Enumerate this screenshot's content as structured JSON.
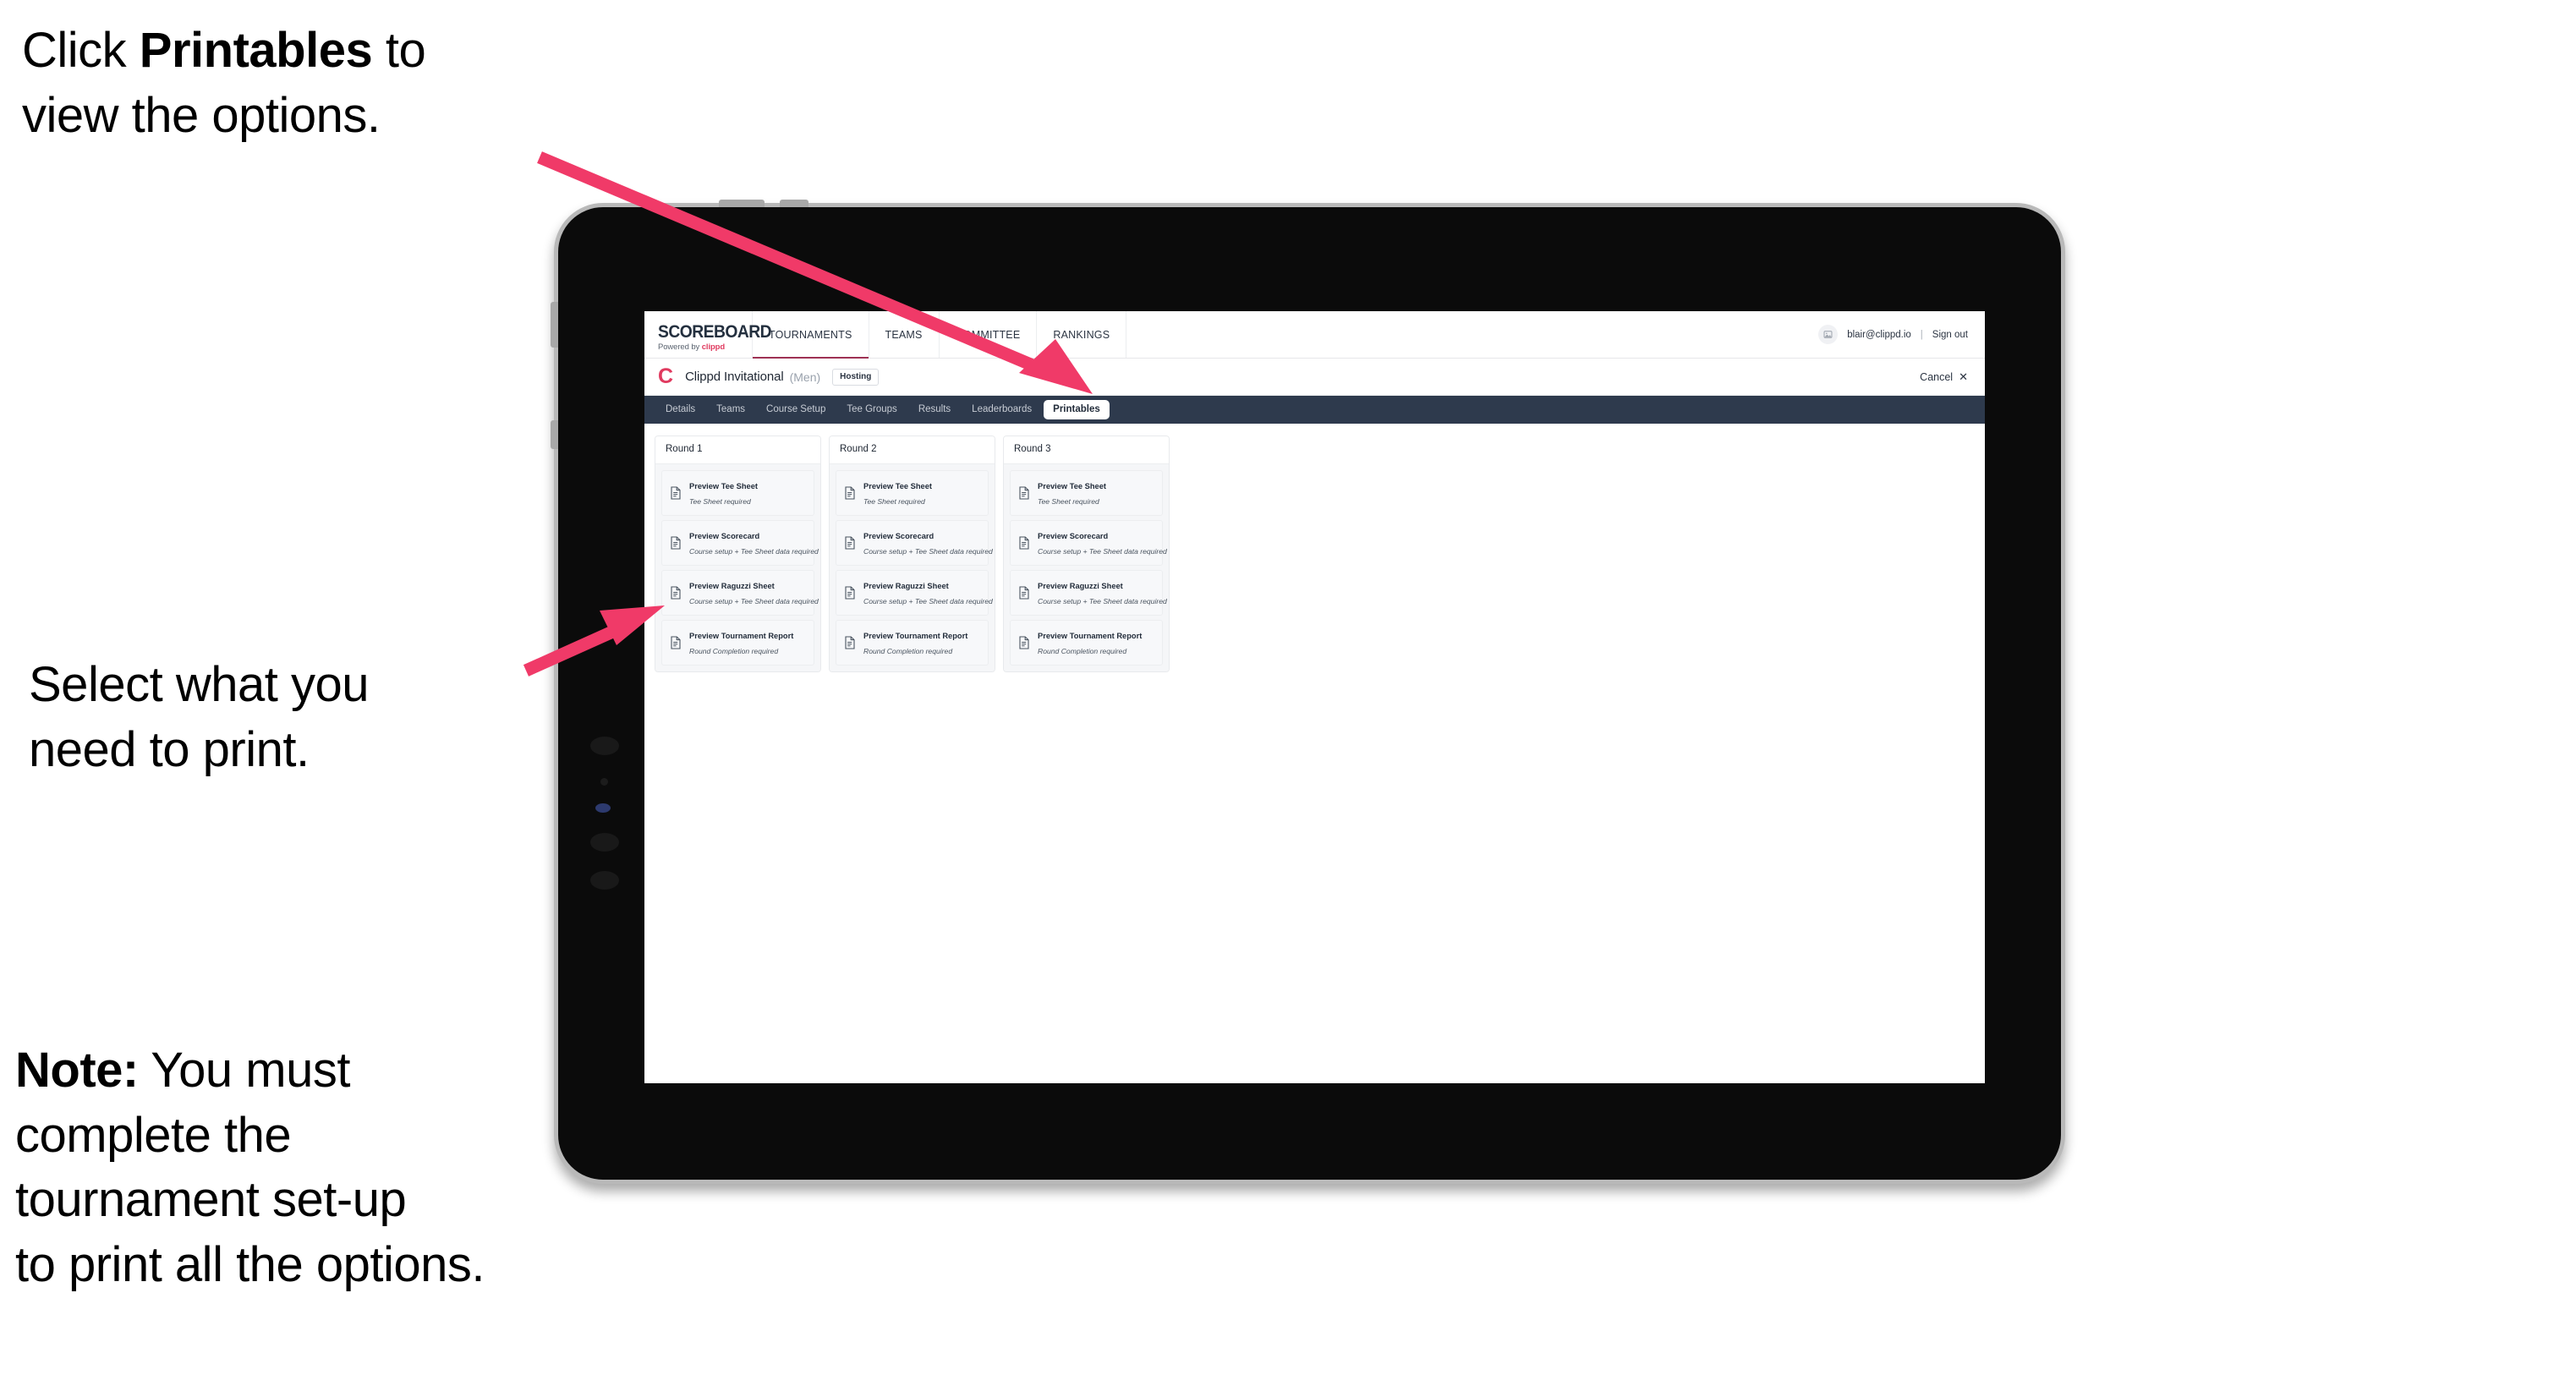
{
  "annotations": {
    "click_printables": {
      "prefix": "Click ",
      "bold": "Printables",
      "suffix": " to\nview the options."
    },
    "select_print": "Select what you\n need to print.",
    "note": {
      "bold": "Note:",
      "text": " You must\ncomplete the\ntournament set-up\nto print all the options."
    }
  },
  "colors": {
    "accent_pink": "#f03a68",
    "brand_red": "#e03a5f",
    "subnav_bg": "#2e3a4d",
    "active_underline": "#9e3254"
  },
  "app": {
    "logo": {
      "word": "SCOREBOARD",
      "powered_by": "Powered by ",
      "brand": "clippd"
    },
    "top_nav": [
      {
        "label": "TOURNAMENTS",
        "active": true
      },
      {
        "label": "TEAMS",
        "active": false
      },
      {
        "label": "COMMITTEE",
        "active": false
      },
      {
        "label": "RANKINGS",
        "active": false
      }
    ],
    "user": {
      "email": "blair@clippd.io",
      "separator": "|",
      "sign_out": "Sign out"
    },
    "tournament": {
      "logo_letter": "C",
      "name": "Clippd Invitational",
      "gender": "(Men)",
      "status_chip": "Hosting",
      "cancel_label": "Cancel",
      "cancel_x": "✕"
    },
    "sub_nav": [
      {
        "label": "Details",
        "active": false
      },
      {
        "label": "Teams",
        "active": false
      },
      {
        "label": "Course Setup",
        "active": false
      },
      {
        "label": "Tee Groups",
        "active": false
      },
      {
        "label": "Results",
        "active": false
      },
      {
        "label": "Leaderboards",
        "active": false
      },
      {
        "label": "Printables",
        "active": true
      }
    ],
    "rounds": [
      {
        "title": "Round 1",
        "items": [
          {
            "title": "Preview Tee Sheet",
            "sub": "Tee Sheet required"
          },
          {
            "title": "Preview Scorecard",
            "sub": "Course setup + Tee Sheet data required"
          },
          {
            "title": "Preview Raguzzi Sheet",
            "sub": "Course setup + Tee Sheet data required"
          },
          {
            "title": "Preview Tournament Report",
            "sub": "Round Completion required"
          }
        ]
      },
      {
        "title": "Round 2",
        "items": [
          {
            "title": "Preview Tee Sheet",
            "sub": "Tee Sheet required"
          },
          {
            "title": "Preview Scorecard",
            "sub": "Course setup + Tee Sheet data required"
          },
          {
            "title": "Preview Raguzzi Sheet",
            "sub": "Course setup + Tee Sheet data required"
          },
          {
            "title": "Preview Tournament Report",
            "sub": "Round Completion required"
          }
        ]
      },
      {
        "title": "Round 3",
        "items": [
          {
            "title": "Preview Tee Sheet",
            "sub": "Tee Sheet required"
          },
          {
            "title": "Preview Scorecard",
            "sub": "Course setup + Tee Sheet data required"
          },
          {
            "title": "Preview Raguzzi Sheet",
            "sub": "Course setup + Tee Sheet data required"
          },
          {
            "title": "Preview Tournament Report",
            "sub": "Round Completion required"
          }
        ]
      }
    ]
  }
}
